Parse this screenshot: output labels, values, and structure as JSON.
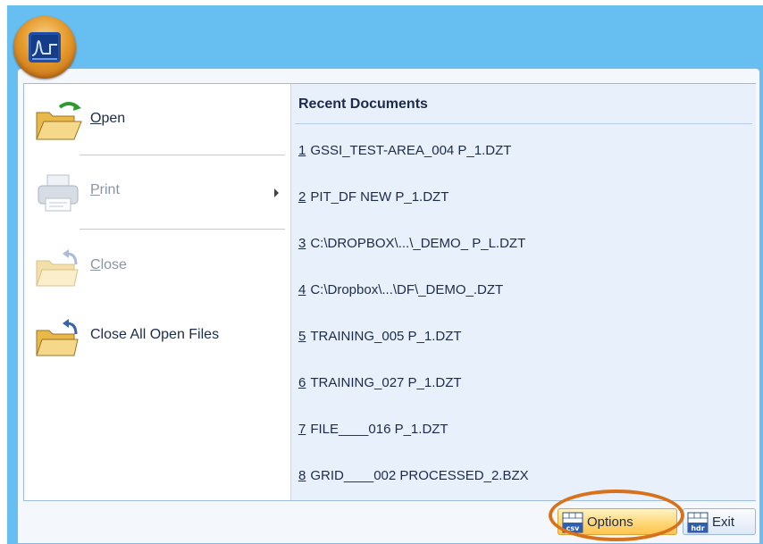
{
  "app_button": {
    "icon": "app-logo-icon"
  },
  "commands": {
    "open": {
      "label_first": "O",
      "label_rest": "pen",
      "icon": "open-folder-icon"
    },
    "print": {
      "label_first": "P",
      "label_rest": "rint",
      "icon": "printer-icon"
    },
    "close": {
      "label_first": "C",
      "label_rest": "lose",
      "icon": "close-folder-icon"
    },
    "close_all": {
      "label": "Close All Open Files",
      "icon": "close-all-folder-icon"
    }
  },
  "recent": {
    "title": "Recent Documents",
    "items": [
      {
        "num": "1",
        "name": "GSSI_TEST-AREA_004 P_1.DZT"
      },
      {
        "num": "2",
        "name": "PIT_DF NEW P_1.DZT"
      },
      {
        "num": "3",
        "name": "C:\\DROPBOX\\...\\_DEMO_ P_L.DZT"
      },
      {
        "num": "4",
        "name": "C:\\Dropbox\\...\\DF\\_DEMO_.DZT"
      },
      {
        "num": "5",
        "name": "TRAINING_005 P_1.DZT"
      },
      {
        "num": "6",
        "name": "TRAINING_027 P_1.DZT"
      },
      {
        "num": "7",
        "name": "FILE____016 P_1.DZT"
      },
      {
        "num": "8",
        "name": "GRID____002 PROCESSED_2.BZX"
      }
    ]
  },
  "footer": {
    "options": {
      "label": "Options",
      "icon": "csv-icon",
      "icon_text": "csv"
    },
    "exit": {
      "label": "Exit",
      "icon": "hdr-icon",
      "icon_text": "hdr"
    }
  },
  "colors": {
    "title_bar": "#67bef0",
    "highlight_oval": "#d8721a",
    "options_hover": "#ffd779"
  }
}
